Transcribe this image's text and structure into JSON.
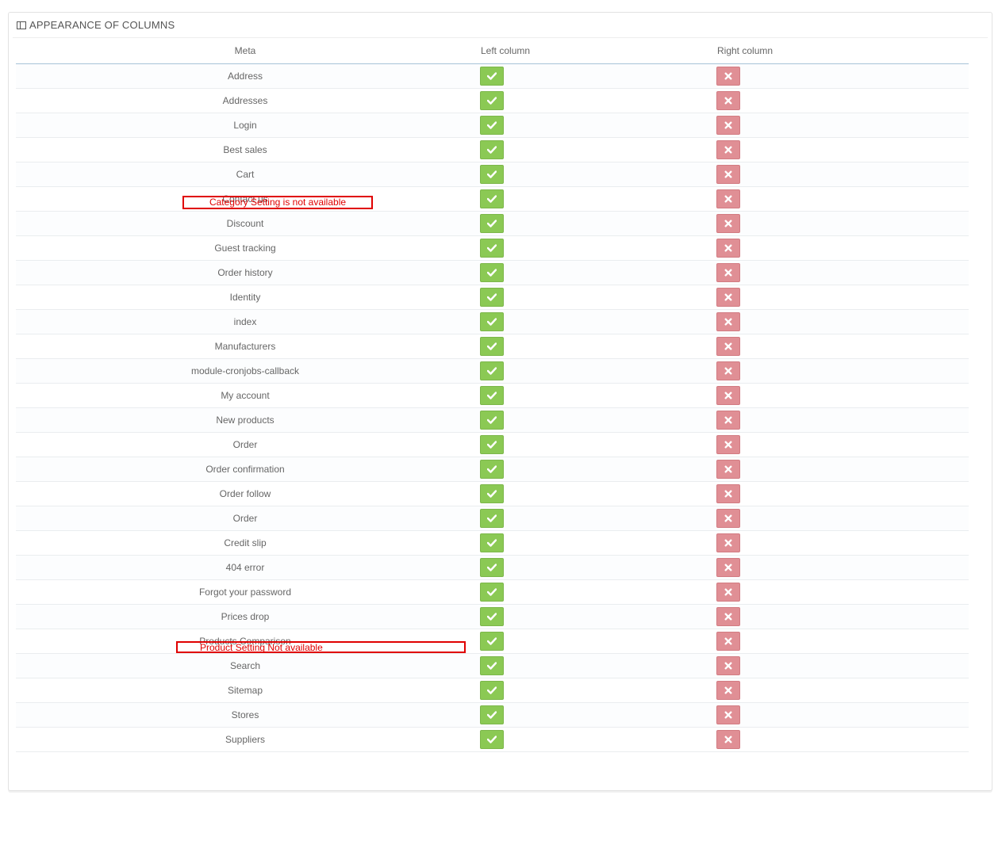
{
  "panel": {
    "title": "APPEARANCE OF COLUMNS",
    "icon": "columns-icon"
  },
  "table": {
    "headers": {
      "meta": "Meta",
      "left": "Left column",
      "right": "Right column"
    },
    "rows": [
      {
        "meta": "Address",
        "left": true,
        "right": false
      },
      {
        "meta": "Addresses",
        "left": true,
        "right": false
      },
      {
        "meta": "Login",
        "left": true,
        "right": false
      },
      {
        "meta": "Best sales",
        "left": true,
        "right": false
      },
      {
        "meta": "Cart",
        "left": true,
        "right": false
      },
      {
        "meta": "Contact us",
        "left": true,
        "right": false
      },
      {
        "meta": "Discount",
        "left": true,
        "right": false
      },
      {
        "meta": "Guest tracking",
        "left": true,
        "right": false
      },
      {
        "meta": "Order history",
        "left": true,
        "right": false
      },
      {
        "meta": "Identity",
        "left": true,
        "right": false
      },
      {
        "meta": "index",
        "left": true,
        "right": false
      },
      {
        "meta": "Manufacturers",
        "left": true,
        "right": false
      },
      {
        "meta": "module-cronjobs-callback",
        "left": true,
        "right": false
      },
      {
        "meta": "My account",
        "left": true,
        "right": false
      },
      {
        "meta": "New products",
        "left": true,
        "right": false
      },
      {
        "meta": "Order",
        "left": true,
        "right": false
      },
      {
        "meta": "Order confirmation",
        "left": true,
        "right": false
      },
      {
        "meta": "Order follow",
        "left": true,
        "right": false
      },
      {
        "meta": "Order",
        "left": true,
        "right": false
      },
      {
        "meta": "Credit slip",
        "left": true,
        "right": false
      },
      {
        "meta": "404 error",
        "left": true,
        "right": false
      },
      {
        "meta": "Forgot your password",
        "left": true,
        "right": false
      },
      {
        "meta": "Prices drop",
        "left": true,
        "right": false
      },
      {
        "meta": "Products Comparison",
        "left": true,
        "right": false
      },
      {
        "meta": "Search",
        "left": true,
        "right": false
      },
      {
        "meta": "Sitemap",
        "left": true,
        "right": false
      },
      {
        "meta": "Stores",
        "left": true,
        "right": false
      },
      {
        "meta": "Suppliers",
        "left": true,
        "right": false
      }
    ]
  },
  "annotations": {
    "category": "Category Setting is not available",
    "product": "Product Setting Not available"
  },
  "colors": {
    "enabled": "#8bc954",
    "disabled": "#e08f95",
    "annotation": "#e00000",
    "header_rule": "#a7c4d8"
  }
}
